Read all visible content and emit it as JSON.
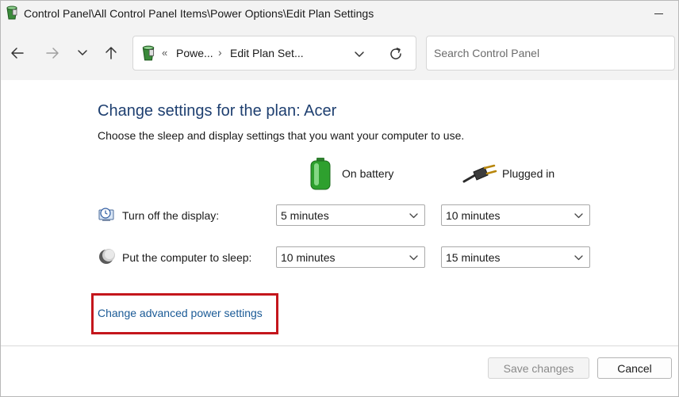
{
  "window": {
    "title": "Control Panel\\All Control Panel Items\\Power Options\\Edit Plan Settings"
  },
  "icons": {
    "app": "control-panel-power-icon",
    "back": "arrow-left-icon",
    "forward": "arrow-right-icon",
    "recent": "chevron-down-icon",
    "up": "arrow-up-icon",
    "refresh": "refresh-icon",
    "battery": "battery-icon",
    "plug": "plug-icon",
    "display": "display-clock-icon",
    "sleep": "moon-icon"
  },
  "address": {
    "separator": "«",
    "crumb_sep": "›",
    "crumbs": [
      "Powe...",
      "Edit Plan Set..."
    ]
  },
  "search": {
    "placeholder": "Search Control Panel",
    "value": ""
  },
  "main": {
    "heading": "Change settings for the plan: Acer",
    "subtext": "Choose the sleep and display settings that you want your computer to use.",
    "columns": [
      "On battery",
      "Plugged in"
    ],
    "rows": [
      {
        "label": "Turn off the display:",
        "battery": "5 minutes",
        "plugged": "10 minutes"
      },
      {
        "label": "Put the computer to sleep:",
        "battery": "10 minutes",
        "plugged": "15 minutes"
      }
    ],
    "advanced_link": "Change advanced power settings"
  },
  "footer": {
    "save_label": "Save changes",
    "cancel_label": "Cancel"
  },
  "colors": {
    "heading": "#1e3f70",
    "link": "#1a5a96",
    "highlight_border": "#c4161c",
    "chrome_bg": "#f3f3f3"
  }
}
